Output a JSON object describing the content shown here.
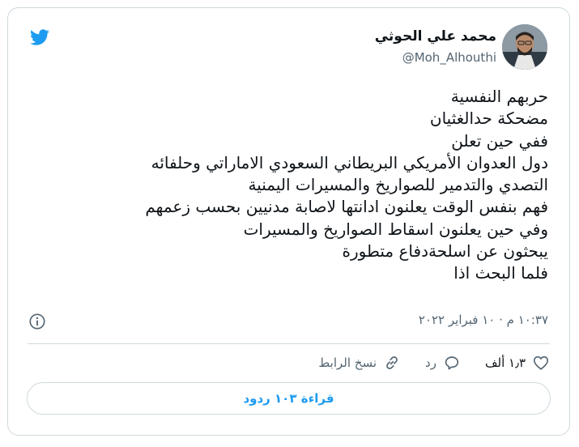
{
  "author": {
    "name": "محمد علي الحوثي",
    "handle": "@Moh_Alhouthi"
  },
  "tweet": {
    "lines": [
      "حربهم النفسية",
      "مضحكة حدالغثيان",
      "ففي حين تعلن",
      "دول العدوان الأمريكي البريطاني السعودي الاماراتي وحلفائه",
      "التصدي والتدمير للصواريخ والمسيرات اليمنية",
      "فهم بنفس الوقت يعلنون ادانتها لاصابة مدنيين بحسب زعمهم",
      "وفي حين يعلنون اسقاط الصواريخ والمسيرات",
      "يبحثون عن اسلحةدفاع متطورة",
      "فلما البحث اذا"
    ],
    "timestamp": "١٠:٣٧ م · ١٠ فبراير ٢٠٢٢"
  },
  "actions": {
    "like_count": "١٫٣ ألف",
    "reply_label": "رد",
    "copy_link_label": "نسخ الرابط"
  },
  "read_replies_label": "قراءة ١٠٣ ردود",
  "colors": {
    "accent": "#1d9bf0",
    "secondary_text": "#536471",
    "border": "#cfd9de"
  },
  "icons": [
    "twitter-bird-icon",
    "info-icon",
    "heart-icon",
    "reply-icon",
    "link-icon"
  ]
}
